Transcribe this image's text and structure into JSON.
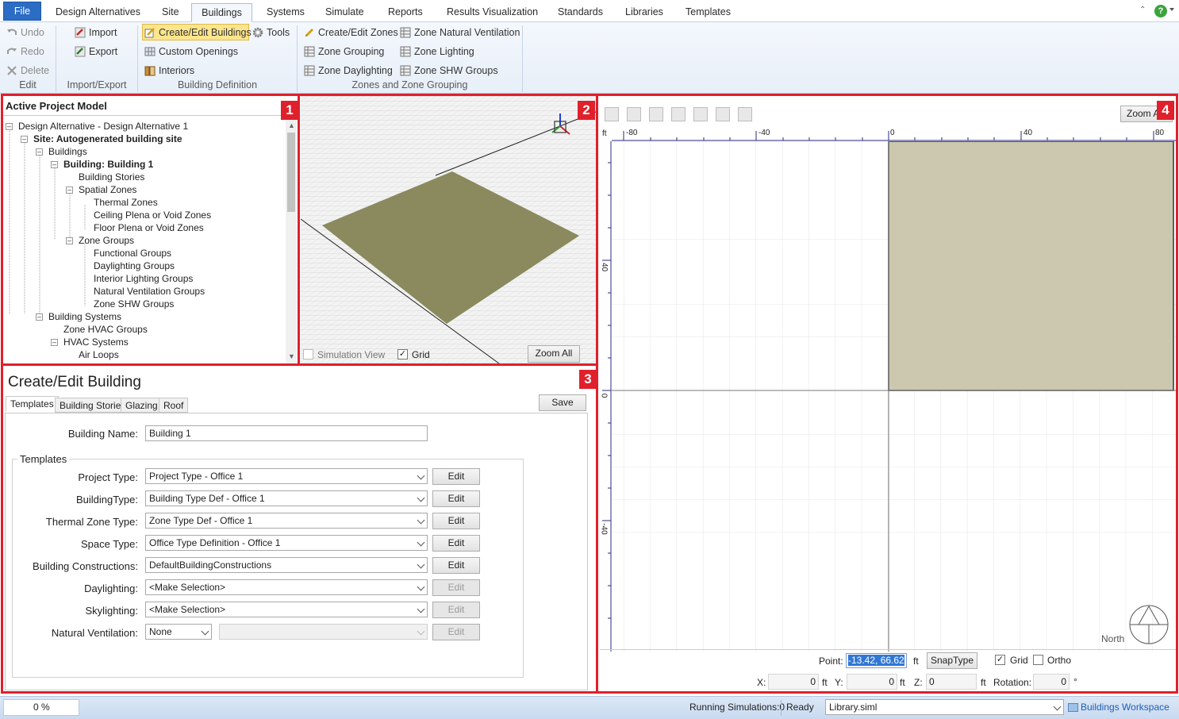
{
  "menu": {
    "file": "File",
    "tabs": [
      "Design Alternatives",
      "Site",
      "Buildings",
      "Systems",
      "Simulate",
      "Reports",
      "Results Visualization",
      "Standards",
      "Libraries",
      "Templates"
    ]
  },
  "ribbon": {
    "undo": "Undo",
    "redo": "Redo",
    "delete": "Delete",
    "edit_group": "Edit",
    "import": "Import",
    "export": "Export",
    "import_export_group": "Import/Export",
    "create_edit_buildings": "Create/Edit Buildings",
    "tools": "Tools",
    "custom_openings": "Custom Openings",
    "interiors": "Interiors",
    "building_definition_group": "Building Definition",
    "create_edit_zones": "Create/Edit Zones",
    "zone_natural_ventilation": "Zone Natural Ventilation",
    "zone_grouping": "Zone Grouping",
    "zone_lighting": "Zone Lighting",
    "zone_daylighting": "Zone Daylighting",
    "zone_shw_groups": "Zone SHW Groups",
    "zones_group": "Zones and Zone Grouping"
  },
  "panel_numbers": [
    "1",
    "2",
    "3",
    "4"
  ],
  "tree": {
    "header": "Active Project Model",
    "items": [
      "Design Alternative - Design Alternative 1",
      "Site: Autogenerated building site",
      "Buildings",
      "Building: Building  1",
      "Building Stories",
      "Spatial Zones",
      "Thermal Zones",
      "Ceiling Plena or Void Zones",
      "Floor Plena or Void Zones",
      "Zone Groups",
      "Functional Groups",
      "Daylighting Groups",
      "Interior Lighting Groups",
      "Natural Ventilation Groups",
      "Zone SHW Groups",
      "Building Systems",
      "Zone HVAC Groups",
      "HVAC Systems",
      "Air Loops"
    ]
  },
  "view3d": {
    "simulation_view": "Simulation View",
    "grid": "Grid",
    "zoom_all": "Zoom All",
    "grid_checked": true,
    "simulation_view_checked": false
  },
  "form": {
    "title": "Create/Edit Building",
    "tabs": [
      "Templates",
      "Building Stories",
      "Glazing",
      "Roof"
    ],
    "save": "Save",
    "building_name_label": "Building Name:",
    "building_name_value": "Building  1",
    "templates_group": "Templates",
    "rows": [
      {
        "label": "Project Type:",
        "value": "Project Type - Office 1",
        "edit": "Edit"
      },
      {
        "label": "BuildingType:",
        "value": "Building Type Def - Office 1",
        "edit": "Edit"
      },
      {
        "label": "Thermal Zone Type:",
        "value": "Zone Type Def - Office 1",
        "edit": "Edit"
      },
      {
        "label": "Space Type:",
        "value": "Office Type Definition - Office 1",
        "edit": "Edit"
      },
      {
        "label": "Building Constructions:",
        "value": "DefaultBuildingConstructions",
        "edit": "Edit"
      },
      {
        "label": "Daylighting:",
        "value": "<Make Selection>",
        "edit": "Edit"
      },
      {
        "label": "Skylighting:",
        "value": "<Make Selection>",
        "edit": "Edit"
      }
    ],
    "natvent_label": "Natural Ventilation:",
    "natvent_value": "None",
    "natvent_edit": "Edit"
  },
  "plan": {
    "zoom_all": "Zoom All",
    "unit": "ft",
    "top_ticks": [
      "-80",
      "-40",
      "0",
      "40",
      "80"
    ],
    "left_ticks": [
      "40",
      "0",
      "-40"
    ],
    "north": "North",
    "point_label": "Point:",
    "point_value": "-13.42, 66.62",
    "point_unit": "ft",
    "snap_type": "SnapType",
    "grid": "Grid",
    "ortho": "Ortho",
    "grid_checked": true,
    "ortho_checked": false,
    "x_label": "X:",
    "x_value": "0",
    "x_unit": "ft",
    "y_label": "Y:",
    "y_value": "0",
    "y_unit": "ft",
    "z_label": "Z:",
    "z_value": "0",
    "z_unit": "ft",
    "rotation_label": "Rotation:",
    "rotation_value": "0",
    "rotation_unit": "°"
  },
  "status": {
    "progress": "0 %",
    "running": "Running Simulations:0",
    "ready": "Ready",
    "library": "Library.siml",
    "workspace": "Buildings Workspace"
  },
  "colors": {
    "accent_red": "#e0202b",
    "file_blue": "#2b6cc4",
    "floor_3d": "#8a8a5e",
    "floor_plan": "#cbc8af"
  }
}
